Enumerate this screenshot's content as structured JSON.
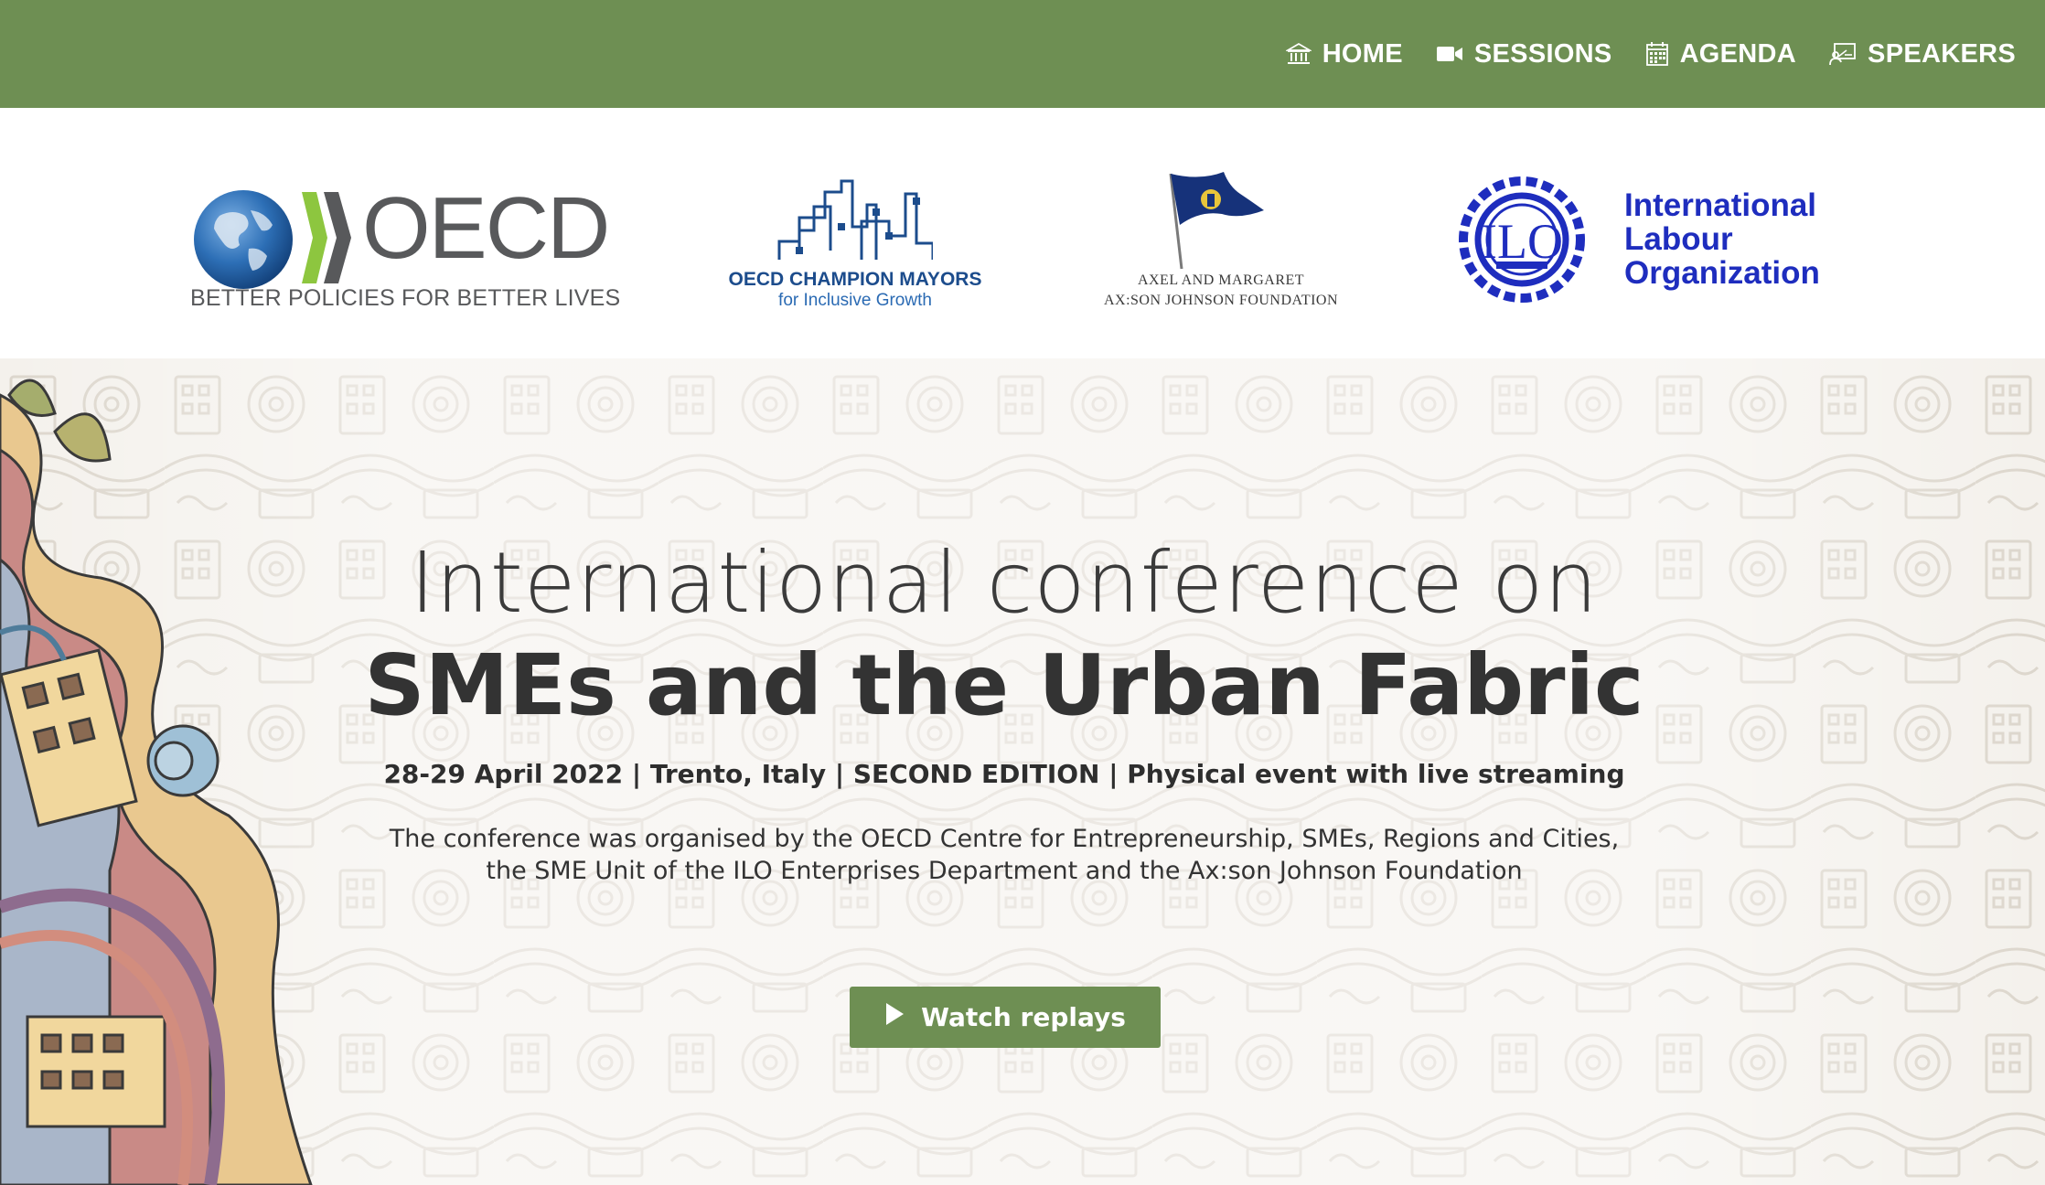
{
  "nav": {
    "items": [
      {
        "label": "HOME",
        "icon": "bank-icon"
      },
      {
        "label": "SESSIONS",
        "icon": "video-camera-icon"
      },
      {
        "label": "AGENDA",
        "icon": "calendar-icon"
      },
      {
        "label": "SPEAKERS",
        "icon": "presenter-icon"
      }
    ]
  },
  "partners": {
    "oecd": {
      "wordmark": "OECD",
      "tagline": "BETTER POLICIES FOR BETTER LIVES"
    },
    "mayors": {
      "title": "OECD CHAMPION MAYORS",
      "subtitle": "for Inclusive Growth"
    },
    "axson": {
      "line1": "AXEL AND MARGARET",
      "line2": "AX:SON JOHNSON FOUNDATION"
    },
    "ilo": {
      "line1": "International",
      "line2": "Labour",
      "line3": "Organization",
      "emblem_text": "ILO"
    }
  },
  "hero": {
    "title_line1": "International conference on",
    "title_line2": "SMEs and the Urban Fabric",
    "subtitle": "28-29 April 2022 | Trento, Italy | SECOND EDITION | Physical event with live streaming",
    "description_line1": "The conference was organised by the OECD Centre for Entrepreneurship, SMEs, Regions and Cities,",
    "description_line2": "the SME Unit of the ILO Enterprises Department and the Ax:son Johnson Foundation",
    "cta_label": "Watch replays"
  },
  "colors": {
    "brand_green": "#6e8f53",
    "ilo_blue": "#1e2dbe",
    "mayors_blue": "#1c4c8c",
    "text_dark": "#333333"
  }
}
